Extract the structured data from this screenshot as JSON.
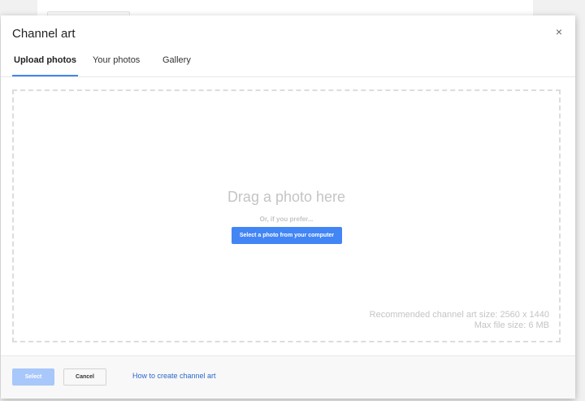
{
  "dialog": {
    "title": "Channel art",
    "close_icon": "×"
  },
  "tabs": [
    {
      "label": "Upload photos",
      "active": true
    },
    {
      "label": "Your photos",
      "active": false
    },
    {
      "label": "Gallery",
      "active": false
    }
  ],
  "dropzone": {
    "heading": "Drag a photo here",
    "prefer": "Or, if you prefer...",
    "select_button": "Select a photo from your computer",
    "recommended": "Recommended channel art size: 2560 x 1440",
    "max_size": "Max file size: 6 MB"
  },
  "footer": {
    "select_label": "Select",
    "select_disabled": true,
    "cancel_label": "Cancel",
    "help_link": "How to create channel art"
  },
  "colors": {
    "accent": "#4285f4",
    "accent_disabled": "#a8c7fa",
    "link": "#2a67c9",
    "hint_text": "#c4c4c4"
  },
  "icons": {
    "close": "close-icon"
  }
}
